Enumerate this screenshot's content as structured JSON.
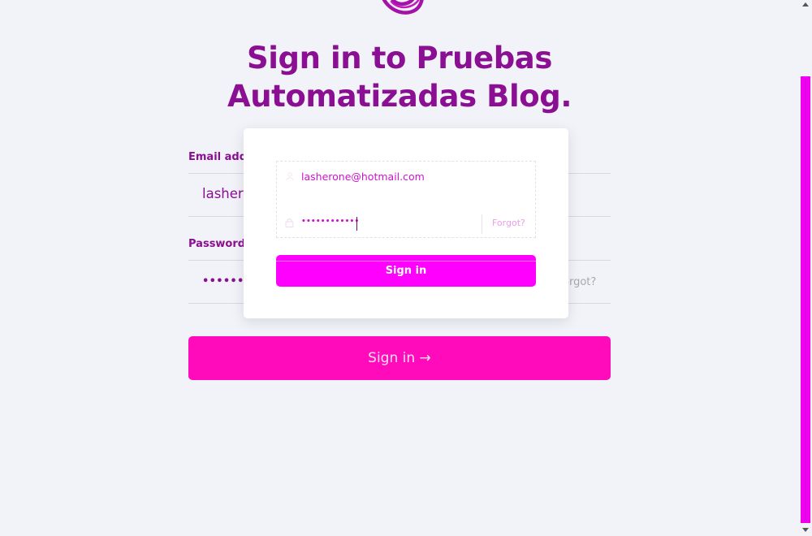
{
  "heading": {
    "line1": "Sign in to Pruebas",
    "line2": "Automatizadas Blog."
  },
  "form": {
    "email_label": "Email address",
    "email_value": "lasherone@hotmail.com",
    "password_label": "Password",
    "password_masked": "••••••••••••",
    "forgot_label": "Forgot?",
    "submit_label": "Sign in →"
  },
  "overlay_card": {
    "email_value": "lasherone@hotmail.com",
    "password_masked": "••••••••••••",
    "forgot_label": "Forgot?",
    "submit_label": "Sign in",
    "icons": [
      "user-icon",
      "lock-icon"
    ]
  },
  "colors": {
    "brand": "#8a0f92",
    "magenta": "#ff00ff",
    "pink_button": "#ff0bbb",
    "background": "#f2f3f8"
  },
  "logo": {
    "icon": "swirl-logo-icon"
  }
}
